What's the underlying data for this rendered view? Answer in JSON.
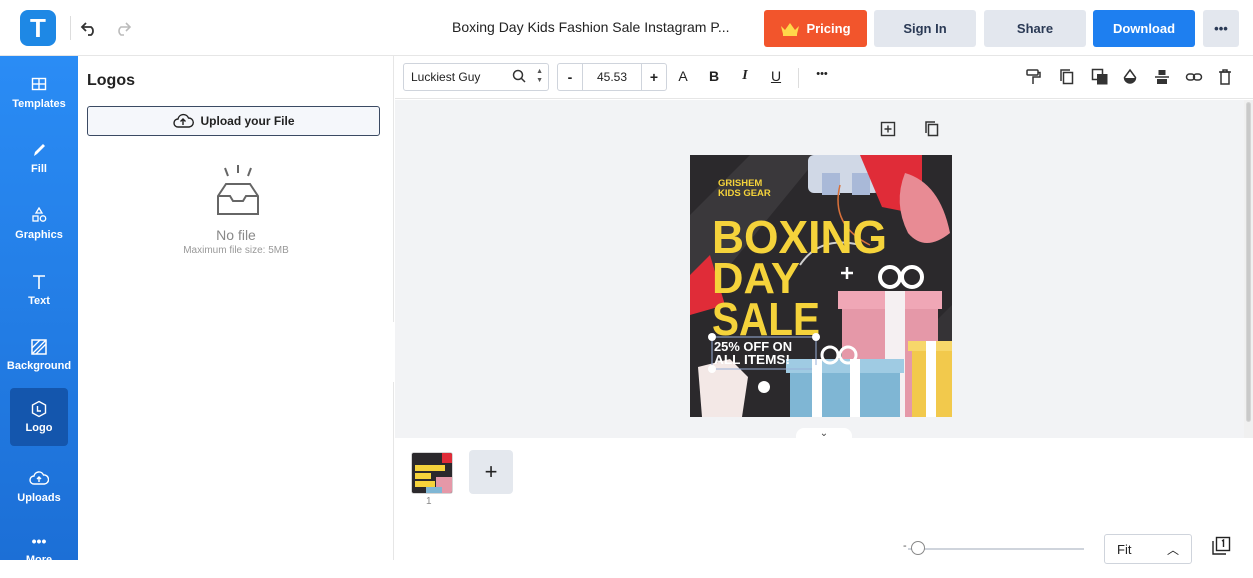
{
  "app": {
    "logo_letter": "T"
  },
  "header": {
    "title": "Boxing Day Kids Fashion Sale Instagram P...",
    "pricing_label": "Pricing",
    "signin_label": "Sign In",
    "share_label": "Share",
    "download_label": "Download",
    "more_label": "•••"
  },
  "sidebar": {
    "items": [
      {
        "label": "Templates",
        "icon": "templates-icon"
      },
      {
        "label": "Fill",
        "icon": "pencil-icon"
      },
      {
        "label": "Graphics",
        "icon": "shapes-icon"
      },
      {
        "label": "Text",
        "icon": "text-icon"
      },
      {
        "label": "Background",
        "icon": "background-icon"
      },
      {
        "label": "Logo",
        "icon": "logo-icon"
      },
      {
        "label": "Uploads",
        "icon": "cloud-upload-icon"
      },
      {
        "label": "More",
        "icon": "more-icon"
      }
    ]
  },
  "panel": {
    "title": "Logos",
    "upload_label": "Upload your File",
    "empty_title": "No file",
    "empty_sub": "Maximum file size: 5MB"
  },
  "toolbar": {
    "font_name": "Luckiest Guy",
    "font_size": "45.53",
    "minus": "-",
    "plus": "+",
    "text_case": "A",
    "bold": "B",
    "italic": "I",
    "underline": "U",
    "more": "•••"
  },
  "design": {
    "brand_line1": "GRISHEM",
    "brand_line2": "KIDS GEAR",
    "headline1": "BOXING",
    "headline2": "DAY",
    "headline3": "SALE",
    "offer_line1": "25% OFF ON",
    "offer_line2": "ALL ITEMS!"
  },
  "pages": {
    "page_number": "1",
    "add_label": "+",
    "zoom_mode": "Fit",
    "zoom_value": 0.03
  },
  "colors": {
    "brand_blue": "#1e88e5",
    "pricing_orange": "#f2552c",
    "download_blue": "#1e7ff0",
    "headline_yellow": "#f5d33b"
  }
}
